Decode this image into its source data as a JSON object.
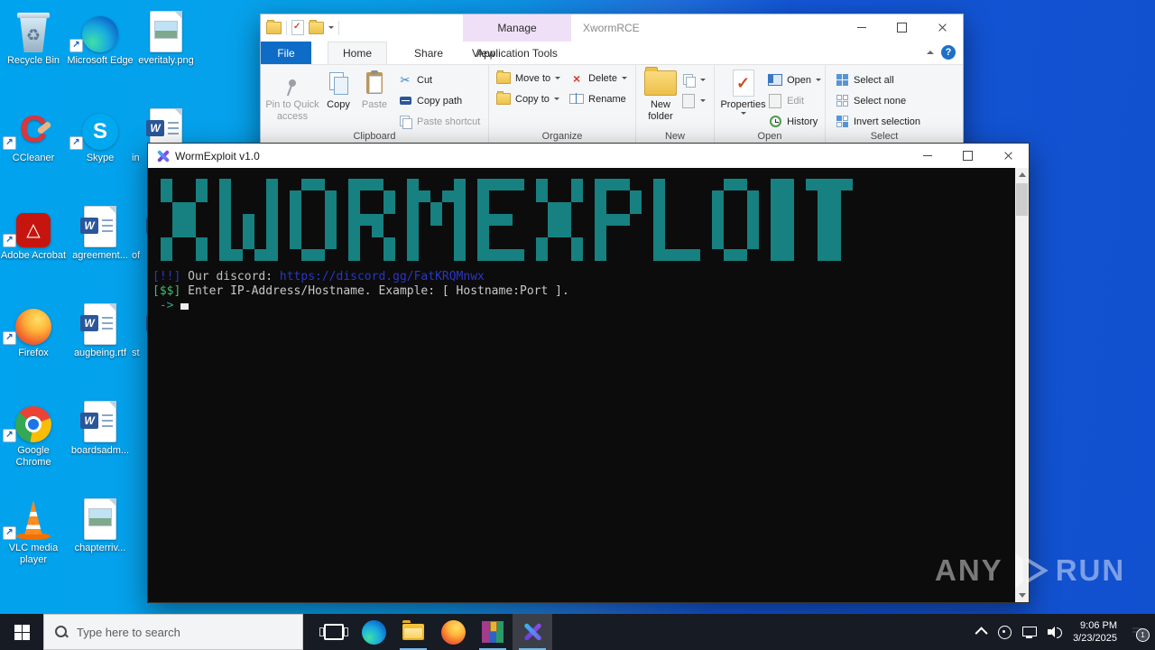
{
  "desktop": {
    "icons": [
      {
        "label": "Recycle Bin",
        "kind": "recycle-bin",
        "col": 0,
        "row": 0,
        "shortcut": false,
        "clipped": false
      },
      {
        "label": "Microsoft Edge",
        "kind": "edge",
        "col": 1,
        "row": 0,
        "shortcut": true,
        "clipped": false
      },
      {
        "label": "everitaly.png",
        "kind": "image-file",
        "col": 2,
        "row": 0,
        "shortcut": false,
        "clipped": false
      },
      {
        "label": "CCleaner",
        "kind": "ccleaner",
        "col": 0,
        "row": 1,
        "shortcut": true,
        "clipped": false
      },
      {
        "label": "Skype",
        "kind": "skype",
        "col": 1,
        "row": 1,
        "shortcut": true,
        "clipped": false
      },
      {
        "label": "in",
        "kind": "word-file",
        "col": 2,
        "row": 1,
        "shortcut": false,
        "clipped": true
      },
      {
        "label": "Adobe Acrobat",
        "kind": "acrobat",
        "col": 0,
        "row": 2,
        "shortcut": true,
        "clipped": false
      },
      {
        "label": "agreement...",
        "kind": "word-file",
        "col": 1,
        "row": 2,
        "shortcut": false,
        "clipped": false
      },
      {
        "label": "of",
        "kind": "word-file",
        "col": 2,
        "row": 2,
        "shortcut": false,
        "clipped": true
      },
      {
        "label": "Firefox",
        "kind": "firefox",
        "col": 0,
        "row": 3,
        "shortcut": true,
        "clipped": false
      },
      {
        "label": "augbeing.rtf",
        "kind": "word-file",
        "col": 1,
        "row": 3,
        "shortcut": false,
        "clipped": false
      },
      {
        "label": "st",
        "kind": "word-file",
        "col": 2,
        "row": 3,
        "shortcut": false,
        "clipped": true
      },
      {
        "label": "Google Chrome",
        "kind": "chrome",
        "col": 0,
        "row": 4,
        "shortcut": true,
        "clipped": false
      },
      {
        "label": "boardsadm...",
        "kind": "word-file",
        "col": 1,
        "row": 4,
        "shortcut": false,
        "clipped": false
      },
      {
        "label": "VLC media player",
        "kind": "vlc",
        "col": 0,
        "row": 5,
        "shortcut": true,
        "clipped": false
      },
      {
        "label": "chapterriv...",
        "kind": "image-file",
        "col": 1,
        "row": 5,
        "shortcut": false,
        "clipped": false
      }
    ]
  },
  "explorer": {
    "title": "XwormRCE",
    "contextual_header": "Manage",
    "help_glyph": "?",
    "tabs": {
      "file": "File",
      "home": "Home",
      "share": "Share",
      "view": "View",
      "app_tools": "Application Tools"
    },
    "ribbon": {
      "clipboard": {
        "label": "Clipboard",
        "pin": "Pin to Quick access",
        "copy": "Copy",
        "paste": "Paste",
        "cut": "Cut",
        "copy_path": "Copy path",
        "paste_shortcut": "Paste shortcut"
      },
      "organize": {
        "label": "Organize",
        "move_to": "Move to",
        "copy_to": "Copy to",
        "delete": "Delete",
        "rename": "Rename"
      },
      "new_group": {
        "label": "New",
        "new_folder": "New folder"
      },
      "open_group": {
        "label": "Open",
        "properties": "Properties",
        "open": "Open",
        "edit": "Edit",
        "history": "History"
      },
      "select_group": {
        "label": "Select",
        "select_all": "Select all",
        "select_none": "Select none",
        "invert": "Invert selection"
      }
    }
  },
  "console": {
    "title": "WormExploit v1.0",
    "banner_text": "XWORMEXPLOIT",
    "banner_color": "#178080",
    "lines": [
      {
        "spans": [
          {
            "text": "[!!]",
            "color": "#2a35c8"
          },
          {
            "text": " Our discord: ",
            "color": "#c0c0c0"
          },
          {
            "text": "https://discord.gg/FatKRQMnwx",
            "color": "#2a35c8"
          }
        ],
        "cursor": false
      },
      {
        "spans": [
          {
            "text": "[$$]",
            "color": "#3fbf6b"
          },
          {
            "text": " Enter IP-Address/Hostname. Example: [ Hostname:Port ].",
            "color": "#c8c8c8"
          }
        ],
        "cursor": false
      },
      {
        "spans": [
          {
            "text": " -> ",
            "color": "#33a08a"
          }
        ],
        "cursor": true
      }
    ]
  },
  "watermark": {
    "any": "ANY",
    "run": "RUN"
  },
  "taskbar": {
    "search_placeholder": "Type here to search",
    "apps": [
      {
        "icon": "task-view",
        "open": false,
        "active": false
      },
      {
        "icon": "edge",
        "open": false,
        "active": false
      },
      {
        "icon": "file-explorer",
        "open": true,
        "active": false
      },
      {
        "icon": "firefox",
        "open": false,
        "active": false
      },
      {
        "icon": "winrar",
        "open": true,
        "active": false
      },
      {
        "icon": "wormexploit",
        "open": true,
        "active": true
      }
    ],
    "clock": {
      "time": "9:06 PM",
      "date": "3/23/2025"
    },
    "notification_badge": "1"
  }
}
